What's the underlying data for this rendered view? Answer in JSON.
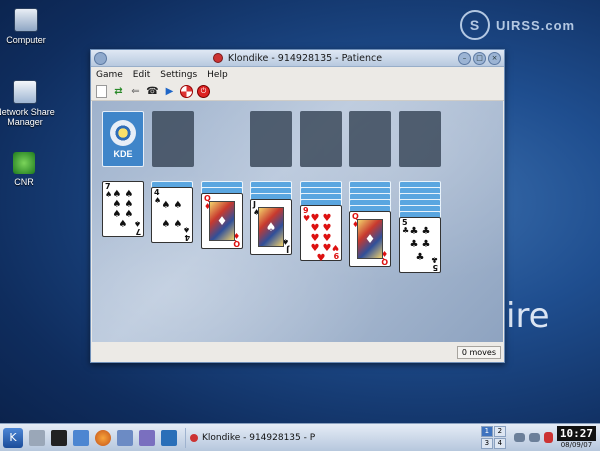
{
  "wallpaper": {
    "brand": "UIRSS.com",
    "brand_logo": "S",
    "word": "ire"
  },
  "desktop_icons": [
    {
      "label": "Computer",
      "icon": "computer-icon"
    },
    {
      "label": "Network Share Manager",
      "icon": "network-share-icon"
    },
    {
      "label": "CNR",
      "icon": "cnr-icon"
    }
  ],
  "window": {
    "title": "Klondike - 914928135 - Patience",
    "menu": [
      "Game",
      "Edit",
      "Settings",
      "Help"
    ],
    "toolbar": [
      "new-game-icon",
      "redeal-icon",
      "undo-icon",
      "hint-icon",
      "play-icon",
      "help-icon",
      "quit-icon"
    ],
    "stock_label": "KDE",
    "tableau": [
      {
        "facedown": 0,
        "rank": "7",
        "suit": "♠",
        "color": "black",
        "pips": 7
      },
      {
        "facedown": 1,
        "rank": "4",
        "suit": "♠",
        "color": "black",
        "pips": 4
      },
      {
        "facedown": 2,
        "rank": "Q",
        "suit": "♦",
        "color": "red",
        "face": true
      },
      {
        "facedown": 3,
        "rank": "J",
        "suit": "♠",
        "color": "black",
        "face": true
      },
      {
        "facedown": 4,
        "rank": "9",
        "suit": "♥",
        "color": "red",
        "pips": 9
      },
      {
        "facedown": 5,
        "rank": "Q",
        "suit": "♦",
        "color": "red",
        "face": true
      },
      {
        "facedown": 6,
        "rank": "5",
        "suit": "♣",
        "color": "black",
        "pips": 5
      }
    ],
    "status": "0 moves"
  },
  "taskbar": {
    "task_title": "Klondike - 914928135 - P",
    "pager": [
      "1",
      "2",
      "3",
      "4"
    ],
    "clock": "10:27",
    "date": "08/09/07"
  }
}
